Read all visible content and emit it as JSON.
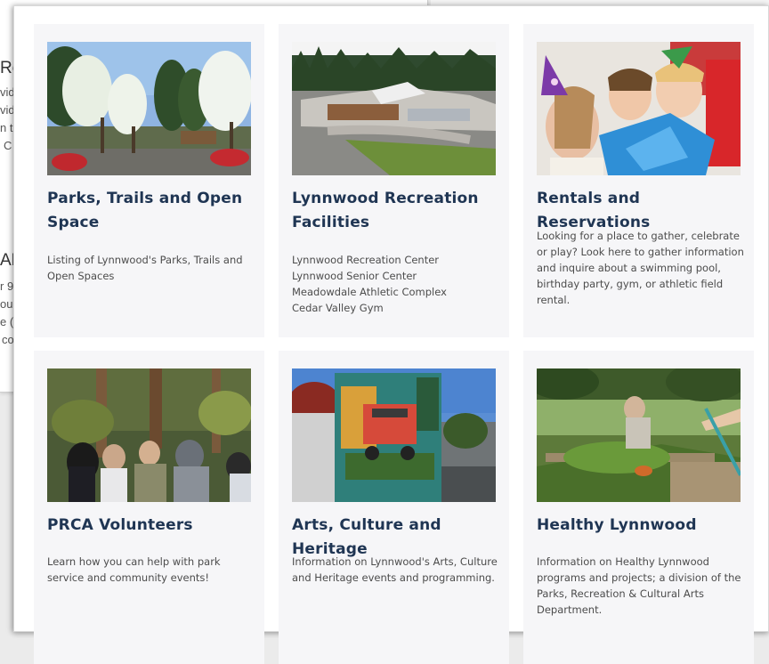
{
  "background_page": {
    "fragments": [
      "Re",
      "vid",
      "vid",
      "n t",
      "C",
      "AE",
      "r 9",
      "ou",
      "e (",
      "co"
    ]
  },
  "cards": [
    {
      "title": "Parks, Trails and Open Space",
      "description": "Listing of Lynnwood's Parks, Trails and Open Spaces",
      "image": "park-photo"
    },
    {
      "title": "Lynnwood Recreation Facilities",
      "lines": [
        "Lynnwood Recreation Center",
        "Lynnwood Senior Center",
        "Meadowdale Athletic Complex",
        "Cedar Valley Gym"
      ],
      "image": "recreation-center-aerial-photo"
    },
    {
      "title": "Rentals and Reservations",
      "description": "Looking for a place to gather, celebrate or play? Look here to gather information and inquire about a swimming pool, birthday party, gym, or athletic field rental.",
      "image": "birthday-party-photo"
    },
    {
      "title": "PRCA Volunteers",
      "description": "Learn how you can help with park service and community events!",
      "image": "volunteers-forest-photo"
    },
    {
      "title": "Arts, Culture and Heritage",
      "description": "Information on Lynnwood's Arts, Culture and Heritage events and programming.",
      "image": "painted-utility-box-photo"
    },
    {
      "title": "Healthy Lynnwood",
      "description": "Information on Healthy Lynnwood programs and projects; a division of the Parks, Recreation & Cultural Arts Department.",
      "image": "garden-bed-photo"
    }
  ],
  "colors": {
    "title": "#1f3553",
    "card_bg": "#f6f6f8",
    "text": "#4c4c4c"
  }
}
